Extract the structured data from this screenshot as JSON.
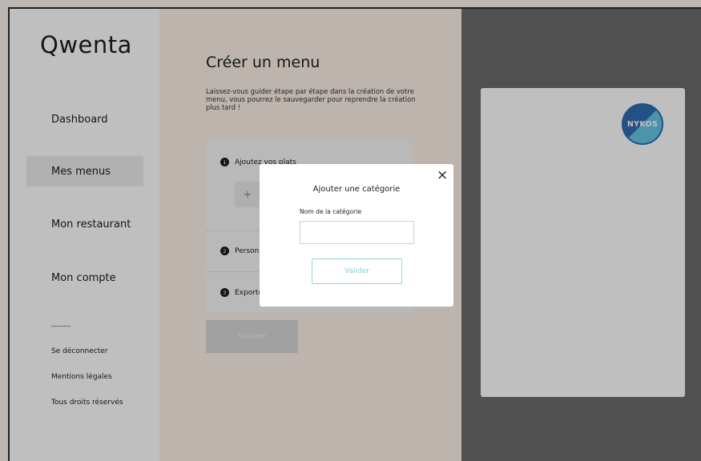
{
  "sidebar": {
    "logo": "Qwenta",
    "items": [
      {
        "label": "Dashboard"
      },
      {
        "label": "Mes menus"
      },
      {
        "label": "Mon restaurant"
      },
      {
        "label": "Mon compte"
      }
    ],
    "footer_links": [
      {
        "label": "Se déconnecter"
      },
      {
        "label": "Mentions légales"
      },
      {
        "label": "Tous droits réservés"
      }
    ]
  },
  "main": {
    "title": "Créer un menu",
    "intro": "Laissez-vous guider étape par étape dans la création de votre menu, vous pourrez le sauvegarder pour reprendre la création plus tard !",
    "steps": [
      {
        "number": "1",
        "label": "Ajoutez vos plats"
      },
      {
        "number": "2",
        "label": "Personnalisez"
      },
      {
        "number": "3",
        "label": "Exportez"
      }
    ],
    "add_symbol": "+",
    "next_button": "Suivant"
  },
  "preview": {
    "logo_text": "NYKOS"
  },
  "modal": {
    "title": "Ajouter une catégorie",
    "field_label": "Nom de la catégorie",
    "field_value": "",
    "submit_label": "Valider",
    "close_symbol": "×"
  },
  "colors": {
    "accent": "#7fd2ce",
    "sidebar_active": "#ececec",
    "main_background": "#fcf1e8"
  }
}
